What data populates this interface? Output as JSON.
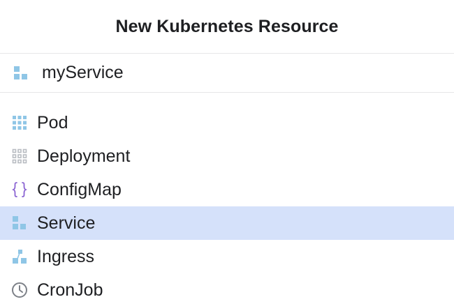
{
  "dialog": {
    "title": "New Kubernetes Resource"
  },
  "name_field": {
    "value": "myService",
    "icon": "service-icon"
  },
  "resource_types": [
    {
      "label": "Pod",
      "icon": "pod-icon",
      "selected": false
    },
    {
      "label": "Deployment",
      "icon": "deployment-icon",
      "selected": false
    },
    {
      "label": "ConfigMap",
      "icon": "configmap-icon",
      "selected": false
    },
    {
      "label": "Service",
      "icon": "service-icon",
      "selected": true
    },
    {
      "label": "Ingress",
      "icon": "ingress-icon",
      "selected": false
    },
    {
      "label": "CronJob",
      "icon": "cronjob-icon",
      "selected": false
    }
  ],
  "colors": {
    "selection": "#d5e1fa",
    "icon_blue": "#8fc6e6",
    "icon_gray": "#b8bcc2",
    "icon_purple": "#8a63d2"
  }
}
